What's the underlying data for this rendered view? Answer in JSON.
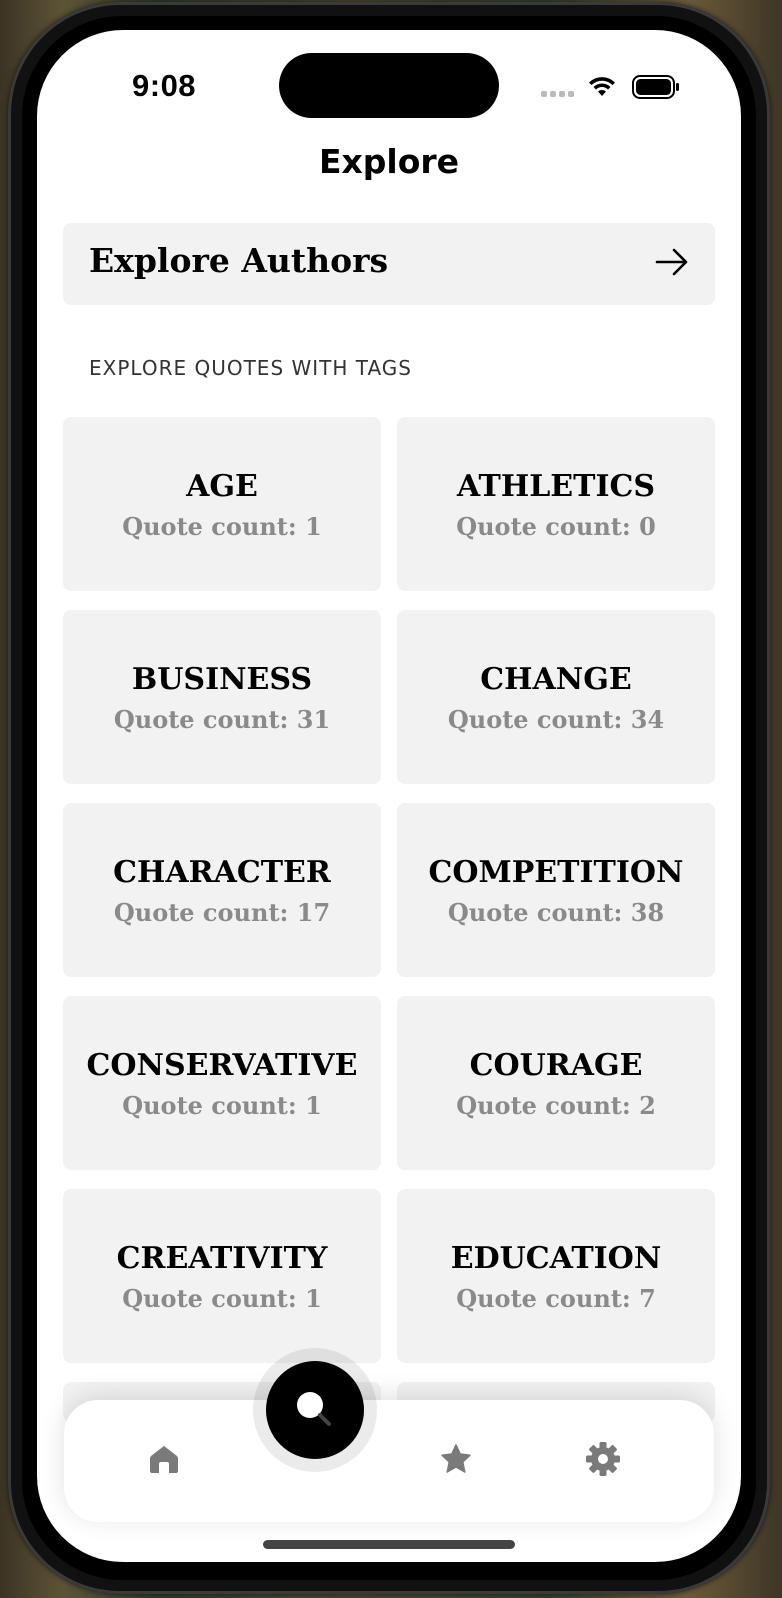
{
  "status_bar": {
    "time": "9:08",
    "icons": [
      "cellular-signal-icon",
      "wifi-icon",
      "battery-icon"
    ]
  },
  "header": {
    "title": "Explore"
  },
  "authors_link": {
    "label": "Explore Authors",
    "icon": "arrow-right-icon"
  },
  "tags_section": {
    "label": "EXPLORE QUOTES WITH TAGS",
    "tags": [
      {
        "name": "AGE",
        "count": "Quote count: 1"
      },
      {
        "name": "ATHLETICS",
        "count": "Quote count: 0"
      },
      {
        "name": "BUSINESS",
        "count": "Quote count: 31"
      },
      {
        "name": "CHANGE",
        "count": "Quote count: 34"
      },
      {
        "name": "CHARACTER",
        "count": "Quote count: 17"
      },
      {
        "name": "COMPETITION",
        "count": "Quote count: 38"
      },
      {
        "name": "CONSERVATIVE",
        "count": "Quote count: 1"
      },
      {
        "name": "COURAGE",
        "count": "Quote count: 2"
      },
      {
        "name": "CREATIVITY",
        "count": "Quote count: 1"
      },
      {
        "name": "EDUCATION",
        "count": "Quote count: 7"
      }
    ]
  },
  "tab_bar": {
    "items": [
      "home-icon",
      "search-icon",
      "star-icon",
      "gear-icon"
    ],
    "active": "search-icon"
  },
  "colors": {
    "tile_bg": "#f2f2f2",
    "count_text": "#8a8a8a",
    "tab_icon": "#7a7a7a",
    "fab_bg": "#000000"
  }
}
